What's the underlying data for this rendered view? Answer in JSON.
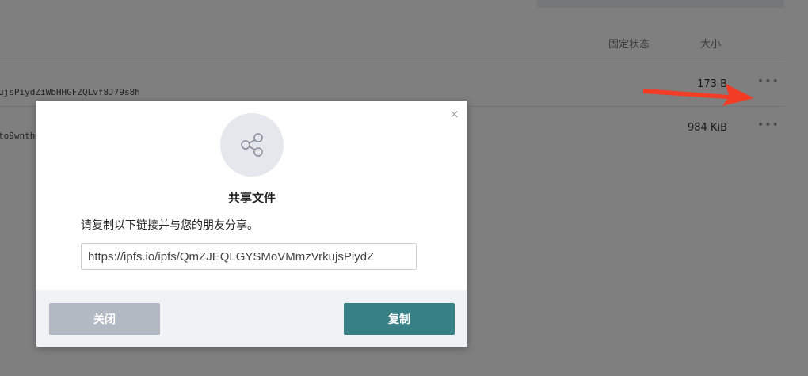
{
  "table": {
    "headers": {
      "pin_status": "固定状态",
      "size": "大小"
    },
    "rows": [
      {
        "hash": "ujsPiydZiWbHHGFZQLvf8J79s8h",
        "size": "173 B",
        "more": "•••"
      },
      {
        "hash": "to9wnth",
        "size": "984 KiB",
        "more": "•••"
      }
    ]
  },
  "annotation": {
    "arrow_color": "#f23c25"
  },
  "modal": {
    "close_symbol": "×",
    "icon": "share-icon",
    "title": "共享文件",
    "description": "请复制以下链接并与您的朋友分享。",
    "link_value": "https://ipfs.io/ipfs/QmZJEQLGYSMoVMmzVrkujsPiydZ",
    "buttons": {
      "close": "关闭",
      "copy": "复制"
    }
  },
  "colors": {
    "copy_button": "#378085",
    "close_button": "#b2b9c3",
    "overlay": "rgba(0,0,0,0.5)"
  }
}
